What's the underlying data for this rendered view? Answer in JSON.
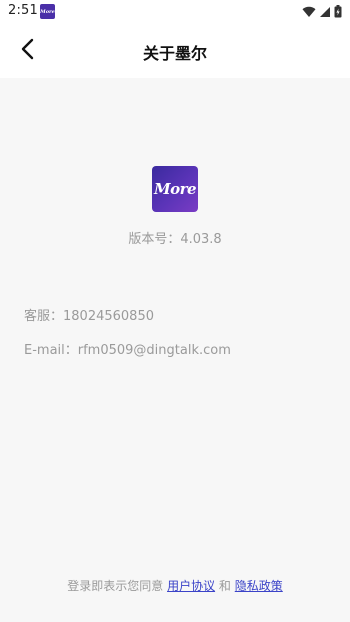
{
  "status_bar": {
    "time": "2:51",
    "app_icon_text": "More"
  },
  "header": {
    "title": "关于墨尔"
  },
  "about": {
    "logo_text": "More",
    "version": "版本号：4.03.8",
    "service": "客服：18024560850",
    "email": "E-mail：rfm0509@dingtalk.com"
  },
  "footer": {
    "prefix": "登录即表示您同意",
    "user_agreement": "用户协议",
    "and": "和",
    "privacy_policy": "隐私政策"
  }
}
